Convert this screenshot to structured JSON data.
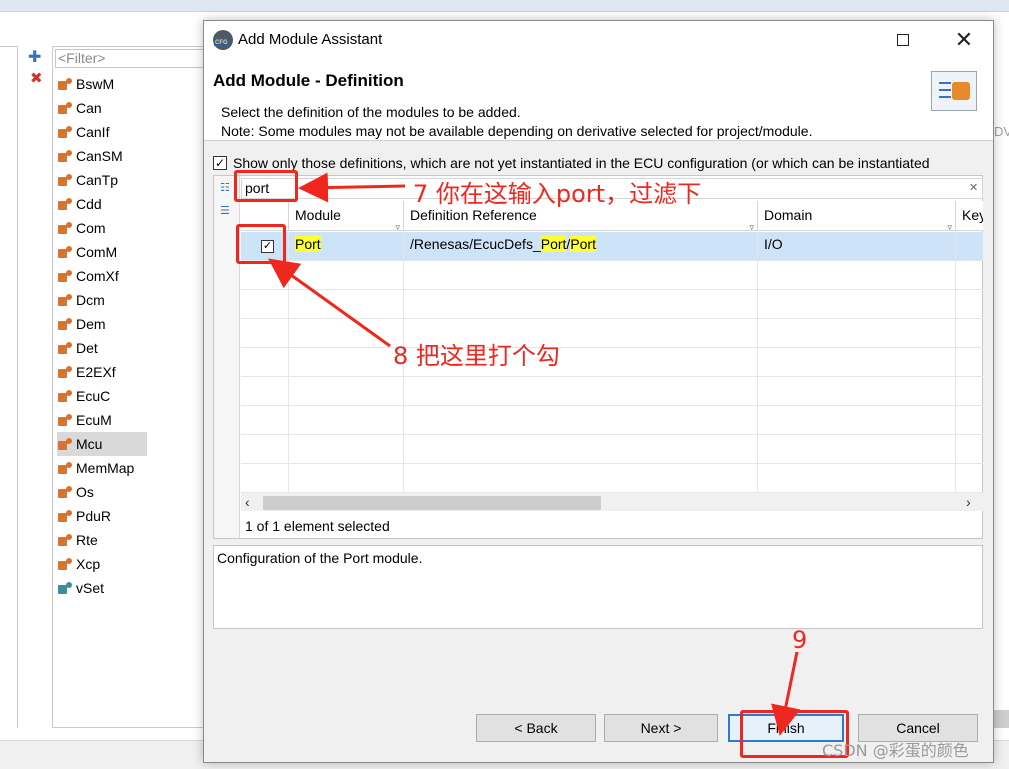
{
  "background": {
    "filter_placeholder": "<Filter>",
    "right_label": "DV",
    "modules": [
      "BswM",
      "Can",
      "CanIf",
      "CanSM",
      "CanTp",
      "Cdd",
      "Com",
      "ComM",
      "ComXf",
      "Dcm",
      "Dem",
      "Det",
      "E2EXf",
      "EcuC",
      "EcuM",
      "Mcu",
      "MemMap",
      "Os",
      "PduR",
      "Rte",
      "Xcp",
      "vSet"
    ],
    "selected_module": "Mcu"
  },
  "dialog": {
    "window_title": "Add Module Assistant",
    "page_title": "Add Module - Definition",
    "description_line1": "Select the definition of the modules to be added.",
    "description_line2": "Note: Some modules may not be available depending on derivative selected for project/module.",
    "checkbox_label": "Show only those definitions, which are not yet instantiated in the ECU configuration (or which can be instantiated",
    "checkbox_checked": true,
    "search_value": "port",
    "columns": [
      "Module",
      "Definition Reference",
      "Domain",
      "Key"
    ],
    "rows": [
      {
        "checked": true,
        "module": "Port",
        "def_prefix": "/Renesas/EcucDefs_",
        "def_hl1": "Port",
        "def_sep": "/",
        "def_hl2": "Port",
        "domain": "I/O"
      }
    ],
    "status": "1 of 1 element selected",
    "module_description": "Configuration of the Port module.",
    "buttons": {
      "back": "< Back",
      "next": "Next >",
      "finish": "Finish",
      "cancel": "Cancel"
    }
  },
  "annotations": {
    "step7": "7 你在这输入port，过滤下",
    "step8": "8 把这里打个勾",
    "step9": "9",
    "color": "#f0271e"
  },
  "watermark": "CSDN @彩蛋的颜色"
}
